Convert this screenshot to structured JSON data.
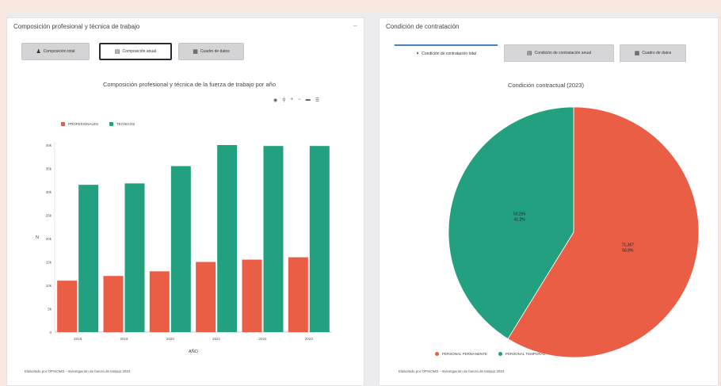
{
  "colors": {
    "profesional": "#ea5e45",
    "tecnicos": "#23a07f",
    "permanente": "#ea5e45",
    "temporal": "#23a07f"
  },
  "left_panel": {
    "title": "Composición profesional y técnica de trabajo",
    "buttons": [
      {
        "label": "Composición total",
        "icon": "user-icon"
      },
      {
        "label": "Composición anual",
        "icon": "bar-chart-icon"
      },
      {
        "label": "Cuadro de datos",
        "icon": "table-icon"
      }
    ],
    "footnote": "Elaborado por OPS/OMS - Investigación de fuerza de trabajo 2023"
  },
  "right_panel": {
    "title": "Condición de contratación",
    "tabs": [
      {
        "label": "Condición de contratación total",
        "icon": "pie-chart-icon"
      },
      {
        "label": "Condición de contratación anual",
        "icon": "bar-chart-icon"
      },
      {
        "label": "Cuadro de datos",
        "icon": "table-icon"
      }
    ],
    "footnote": "Elaborado por OPS/OMS - Investigación de fuerza de trabajo 2023"
  },
  "chart_data": [
    {
      "type": "bar",
      "title": "Composición profesional y técnica de la fuerza de trabajo por año",
      "xlabel": "AÑO",
      "ylabel": "N",
      "categories": [
        "2018",
        "2019",
        "2020",
        "2021",
        "2022",
        "2023"
      ],
      "series": [
        {
          "name": "PROFESIONALES",
          "values": [
            11000,
            12000,
            13000,
            15000,
            15500,
            16000
          ]
        },
        {
          "name": "TECNICOS",
          "values": [
            31500,
            31800,
            35500,
            40000,
            39800,
            39800
          ]
        }
      ],
      "yticks": [
        "0",
        "5k",
        "10k",
        "15k",
        "20k",
        "25k",
        "30k",
        "35k",
        "40k"
      ],
      "ylim": [
        0,
        40000
      ],
      "legend": "top-left"
    },
    {
      "type": "pie",
      "title": "Condición contractual (2023)",
      "slices": [
        {
          "name": "PERSONAL PERMANENTE",
          "value": 58.8,
          "label_count": "71,367",
          "label_pct": "58.8%"
        },
        {
          "name": "PERSONAL TEMPORAL",
          "value": 41.2,
          "label_count": "50,265",
          "label_pct": "41.2%"
        }
      ],
      "legend": "bottom"
    }
  ],
  "toolbar_icons": [
    "camera-icon",
    "zoom-icon",
    "plus-icon",
    "minus-icon",
    "pan-icon",
    "menu-icon"
  ]
}
